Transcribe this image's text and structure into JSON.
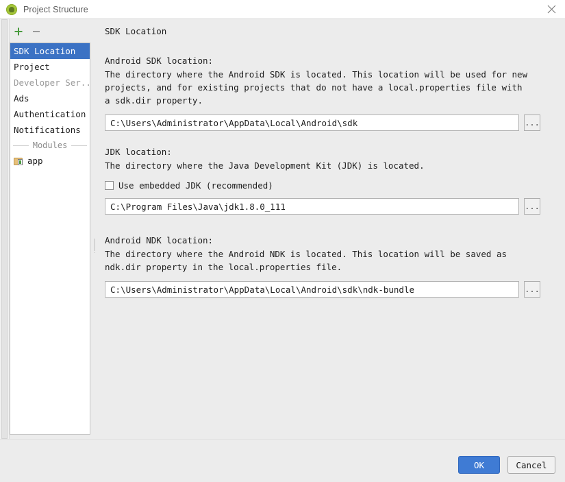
{
  "window": {
    "title": "Project Structure",
    "app_icon": "android-studio-icon",
    "close_icon": "close-icon"
  },
  "toolbar": {
    "add_label": "+",
    "add_icon": "plus-icon",
    "remove_label": "−",
    "remove_icon": "minus-icon"
  },
  "sidebar": {
    "items": [
      {
        "label": "SDK Location",
        "selected": true,
        "dimmed": false
      },
      {
        "label": "Project",
        "selected": false,
        "dimmed": false
      },
      {
        "label": "Developer Ser...",
        "selected": false,
        "dimmed": true
      },
      {
        "label": "Ads",
        "selected": false,
        "dimmed": false
      },
      {
        "label": "Authentication",
        "selected": false,
        "dimmed": false
      },
      {
        "label": "Notifications",
        "selected": false,
        "dimmed": false
      }
    ],
    "separator_label": "Modules",
    "modules": [
      {
        "label": "app",
        "icon": "module-folder-icon"
      }
    ]
  },
  "main": {
    "pane_title": "SDK Location",
    "sections": [
      {
        "heading": "Android SDK location:",
        "description": "The directory where the Android SDK is located. This location will be used for new projects, and for existing projects that do not have a local.properties file with a sdk.dir property.",
        "value": "C:\\Users\\Administrator\\AppData\\Local\\Android\\sdk",
        "placeholder": "",
        "browse_label": "..."
      },
      {
        "heading": "JDK location:",
        "description": "The directory where the Java Development Kit (JDK) is located.",
        "checkbox_label": "Use embedded JDK (recommended)",
        "checkbox_checked": false,
        "value": "C:\\Program Files\\Java\\jdk1.8.0_111",
        "placeholder": "",
        "browse_label": "..."
      },
      {
        "heading": "Android NDK location:",
        "description": "The directory where the Android NDK is located. This location will be saved as ndk.dir property in the local.properties file.",
        "value": "C:\\Users\\Administrator\\AppData\\Local\\Android\\sdk\\ndk-bundle",
        "placeholder": "",
        "browse_label": "..."
      }
    ]
  },
  "footer": {
    "ok_label": "OK",
    "cancel_label": "Cancel"
  },
  "colors": {
    "selection_blue": "#3b72c4",
    "ok_button_blue": "#3f7bd4",
    "window_bg": "#ececec",
    "panel_white": "#ffffff",
    "android_green": "#a4c639"
  }
}
